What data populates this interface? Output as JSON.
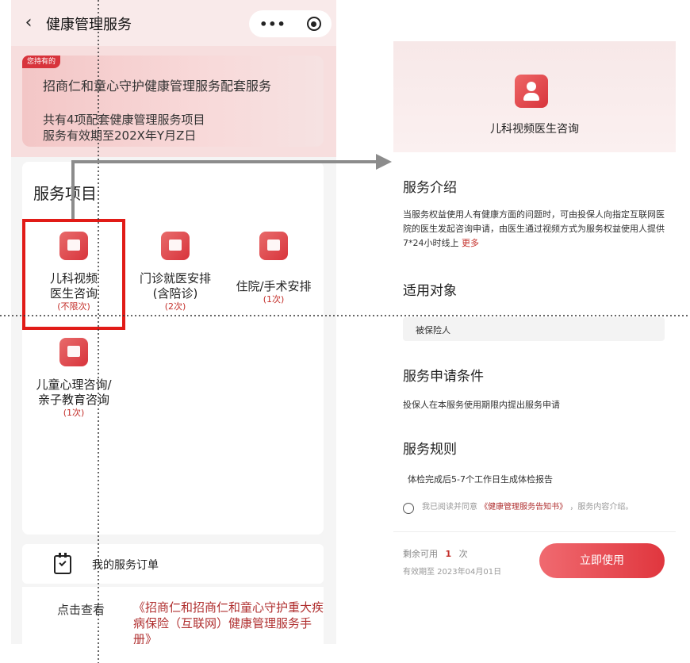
{
  "left": {
    "header": {
      "back_icon": "chevron-left-icon",
      "title": "健康管理服务",
      "more_icon": "more-dots-icon",
      "close_icon": "target-close-icon"
    },
    "banner": {
      "tag": "您持有的",
      "title": "招商仁和童心守护健康管理服务配套服务",
      "line1": "共有4项配套健康管理服务项目",
      "line2": "服务有效期至202X年Y月Z日"
    },
    "services": {
      "title": "服务项目",
      "items": [
        {
          "name_1": "儿科视频",
          "name_2": "医生咨询",
          "count": "(不限次)",
          "icon": "video-consult-icon"
        },
        {
          "name_1": "门诊就医安排",
          "name_2": "(含陪诊)",
          "count": "(2次)",
          "icon": "clinic-icon"
        },
        {
          "name_1": "住院/手术安排",
          "name_2": "",
          "count": "(1次)",
          "icon": "hospital-icon"
        },
        {
          "name_1": "儿童心理咨询/",
          "name_2": "亲子教育咨询",
          "count": "(1次)",
          "icon": "cart-icon"
        }
      ]
    },
    "orders": {
      "label": "我的服务订单",
      "icon": "calendar-check-icon"
    },
    "manual": {
      "prefix": "点击查看",
      "link": "《招商仁和招商仁和童心守护重大疾病保险（互联网）健康管理服务手册》"
    }
  },
  "right": {
    "header": {
      "service_name": "儿科视频医生咨询",
      "icon": "doctor-icon"
    },
    "intro": {
      "title": "服务介绍",
      "text": "当服务权益使用人有健康方面的问题时，可由投保人向指定互联网医院的医生发起咨询申请，由医生通过视频方式为服务权益使用人提供7*24小时线上",
      "more": "更多"
    },
    "target": {
      "title": "适用对象",
      "value": "被保险人"
    },
    "condition": {
      "title": "服务申请条件",
      "text": "投保人在本服务使用期限内提出服务申请"
    },
    "rules": {
      "title": "服务规则",
      "text": "体检完成后5-7个工作日生成体检报告"
    },
    "agreement": {
      "prefix": "我已阅读并同意",
      "doc": "《健康管理服务告知书》",
      "suffix": "，服务内容介绍。"
    },
    "footer": {
      "remaining_label": "剩余可用",
      "remaining_count": "1",
      "remaining_unit": "次",
      "validity": "有效期至 2023年04月01日",
      "use_button": "立即使用"
    }
  },
  "colors": {
    "brand_red": "#d8343c",
    "highlight_border": "#e11b17",
    "link_red": "#b03030",
    "arrow_gray": "#8c8c8c"
  }
}
